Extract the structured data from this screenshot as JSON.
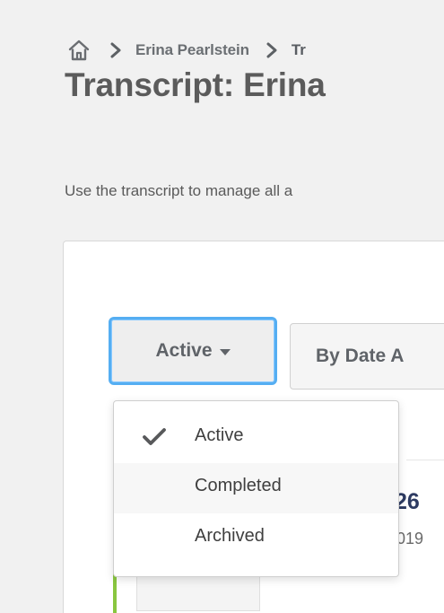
{
  "breadcrumb": {
    "home_icon": "home-icon",
    "separator_icon": "chevron-right-icon",
    "items": [
      {
        "label": "Erina Pearlstein"
      },
      {
        "label": "Tr"
      }
    ]
  },
  "page": {
    "title": "Transcript: Erina",
    "description": "Use the transcript to manage all a"
  },
  "filters": {
    "status_button": {
      "label": "Active"
    },
    "sort_button": {
      "label": "By Date A"
    },
    "menu": {
      "items": [
        {
          "label": "Active",
          "selected": true,
          "icon": "checkmark-icon"
        },
        {
          "label": "Completed",
          "selected": false
        },
        {
          "label": "Archived",
          "selected": false
        }
      ]
    }
  },
  "record": {
    "id_fragment": "26",
    "date_fragment": "019"
  },
  "colors": {
    "accent_focus": "#55aef2",
    "title_text": "#5b5b5b",
    "record_accent": "#89c63f",
    "record_id": "#2d3b62"
  }
}
